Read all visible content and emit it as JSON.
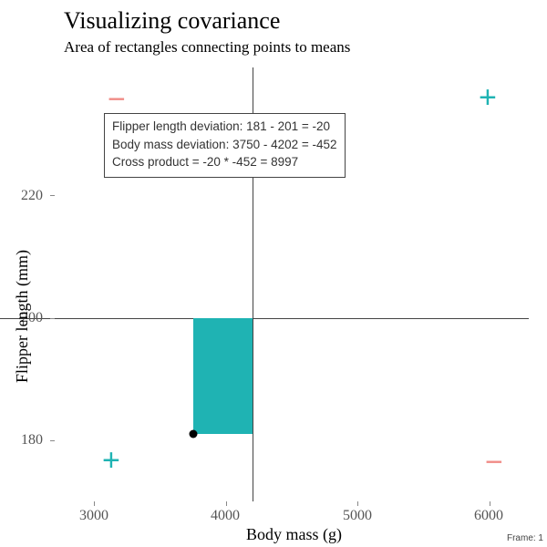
{
  "title": "Visualizing covariance",
  "subtitle": "Area of rectangles connecting points to means",
  "axes": {
    "x_title": "Body mass (g)",
    "y_title": "Flipper length (mm)",
    "x_ticks": [
      "3000",
      "4000",
      "5000",
      "6000"
    ],
    "y_ticks": [
      "180",
      "200",
      "220"
    ]
  },
  "quadrants": {
    "top_right": "+",
    "top_left": "−",
    "bottom_left": "+",
    "bottom_right": "−"
  },
  "annotation": {
    "line1": "Flipper length deviation: 181 - 201 = -20",
    "line2": "Body mass deviation: 3750 - 4202 = -452",
    "line3": "Cross product = -20 * -452 = 8997"
  },
  "frame": "Frame: 1",
  "chart_data": {
    "type": "scatter",
    "title": "Visualizing covariance",
    "subtitle": "Area of rectangles connecting points to means",
    "xlabel": "Body mass (g)",
    "ylabel": "Flipper length (mm)",
    "xlim": [
      2700,
      6300
    ],
    "ylim": [
      170,
      240
    ],
    "mean_x": 4202,
    "mean_y": 201,
    "x": [
      3750
    ],
    "y": [
      181
    ],
    "rect": {
      "x0": 3750,
      "x1": 4202,
      "y0": 181,
      "y1": 200
    },
    "fill_color": "#1fb3b3",
    "quadrant_signs": {
      "top_right": "+",
      "top_left": "-",
      "bottom_left": "+",
      "bottom_right": "-"
    },
    "annotations": [
      "Flipper length deviation: 181 - 201 = -20",
      "Body mass deviation: 3750 - 4202 = -452",
      "Cross product = -20 * -452 = 8997"
    ],
    "frame": 1
  }
}
